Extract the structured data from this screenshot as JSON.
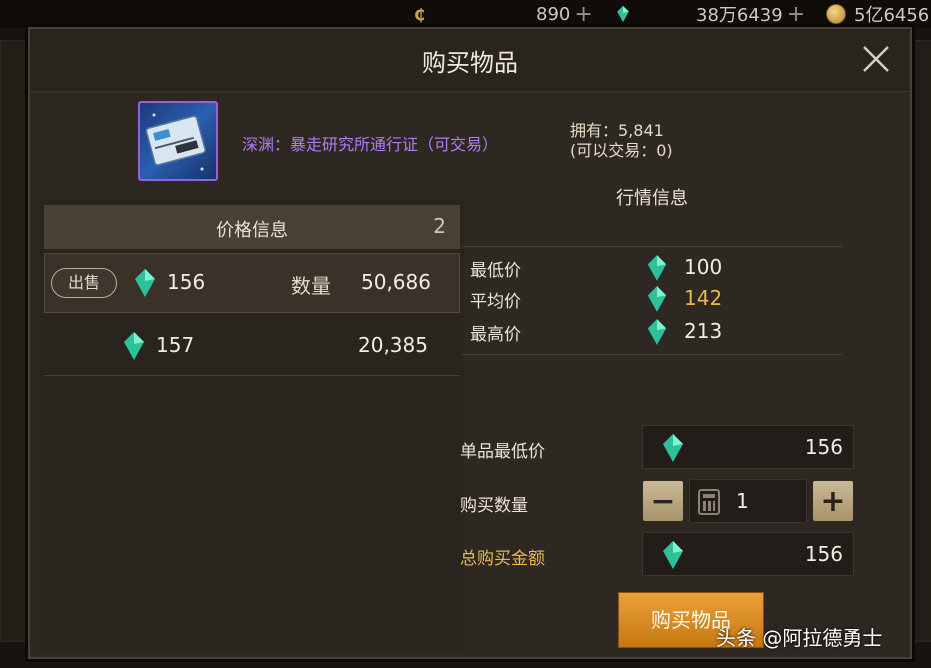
{
  "top_bar": {
    "coin_amount": "890",
    "gem_amount": "38万6439",
    "gold_amount": "5亿6456"
  },
  "dialog": {
    "title": "购买物品",
    "item": {
      "name": "深渊：暴走研究所通行证（可交易）",
      "owned_label": "拥有：5,841",
      "tradable_label": "(可以交易：0)",
      "rarity_color": "#9b5fd6"
    },
    "price_info": {
      "title": "价格信息",
      "count": "2",
      "quantity_label": "数量",
      "sell_badge": "出售",
      "listings": [
        {
          "price": "156",
          "quantity": "50,686"
        },
        {
          "price": "157",
          "quantity": "20,385"
        }
      ]
    },
    "market_info": {
      "title": "行情信息",
      "stats": [
        {
          "label": "最低价",
          "value": "100"
        },
        {
          "label": "平均价",
          "value": "142"
        },
        {
          "label": "最高价",
          "value": "213"
        }
      ]
    },
    "purchase": {
      "unit_price_label": "单品最低价",
      "unit_price": "156",
      "quantity_label": "购买数量",
      "quantity": "1",
      "total_label": "总购买金额",
      "total": "156",
      "buy_button": "购买物品"
    }
  },
  "watermark": "头条 @阿拉德勇士",
  "colors": {
    "accent_gold": "#e6b94a",
    "buy_button": "#d98a22",
    "item_name": "#b07cf0"
  },
  "icons": [
    "coin-icon",
    "gem-icon",
    "gold-coin-icon",
    "close-icon",
    "calculator-icon",
    "minus-icon",
    "plus-icon"
  ]
}
